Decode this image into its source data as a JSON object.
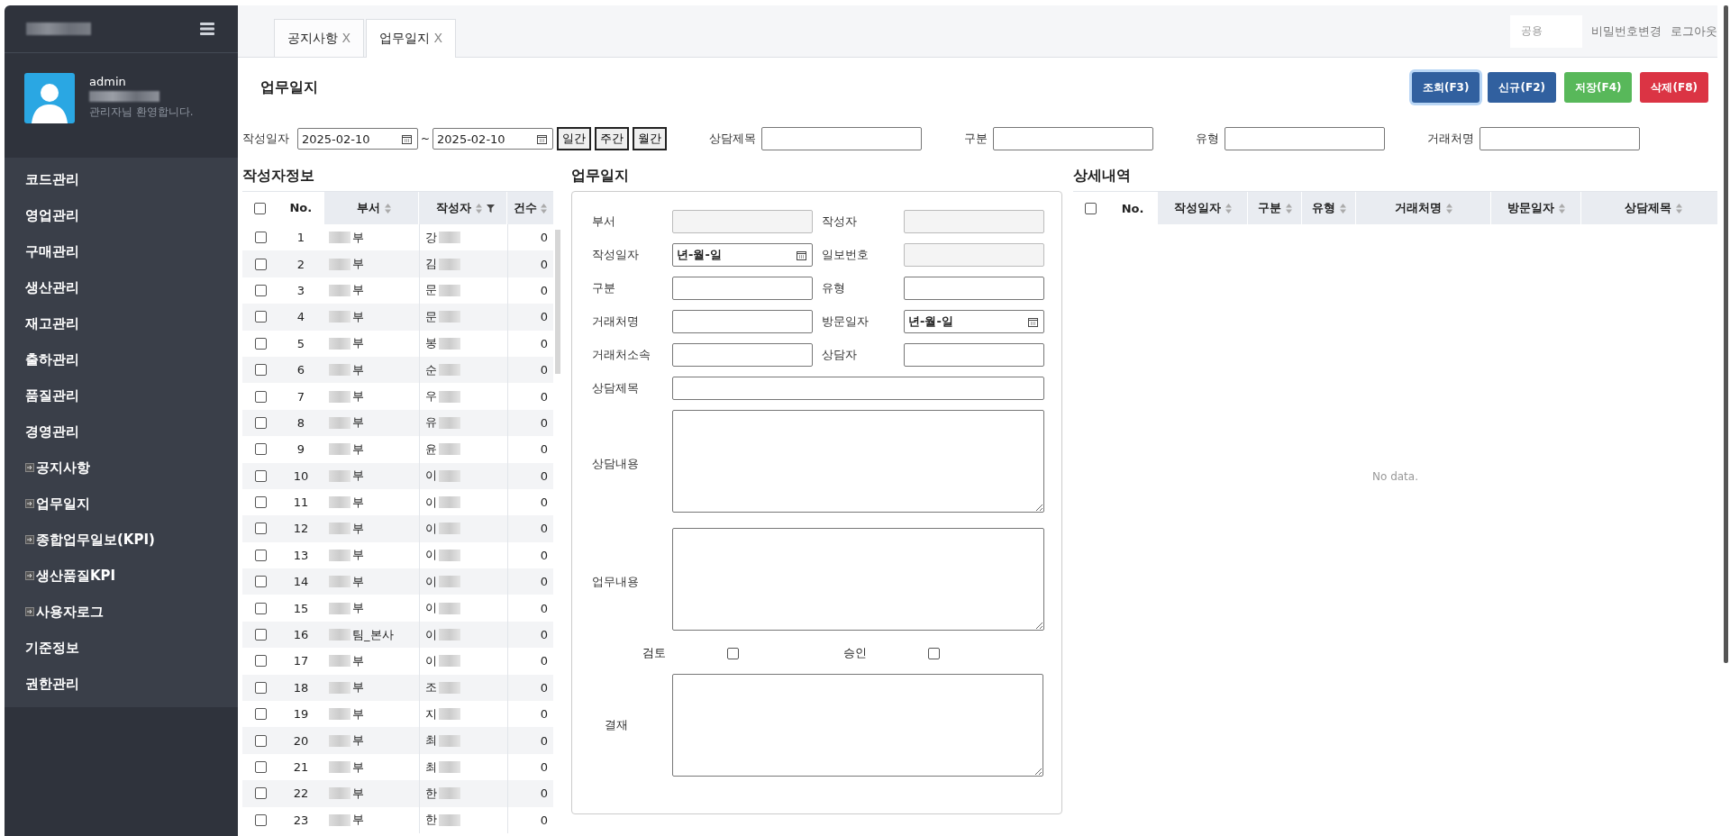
{
  "sidebar": {
    "user": {
      "name": "admin",
      "greeting": "관리자님 환영합니다."
    },
    "menu": [
      {
        "label": "코드관리",
        "kind": "group"
      },
      {
        "label": "영업관리",
        "kind": "group"
      },
      {
        "label": "구매관리",
        "kind": "group"
      },
      {
        "label": "생산관리",
        "kind": "group"
      },
      {
        "label": "재고관리",
        "kind": "group"
      },
      {
        "label": "출하관리",
        "kind": "group"
      },
      {
        "label": "품질관리",
        "kind": "group"
      },
      {
        "label": "경영관리",
        "kind": "group"
      },
      {
        "label": "공지사항",
        "kind": "page"
      },
      {
        "label": "업무일지",
        "kind": "page"
      },
      {
        "label": "종합업무일보(KPI)",
        "kind": "page"
      },
      {
        "label": "생산품질KPI",
        "kind": "page"
      },
      {
        "label": "사용자로그",
        "kind": "page"
      },
      {
        "label": "기준정보",
        "kind": "group"
      },
      {
        "label": "권한관리",
        "kind": "group"
      }
    ]
  },
  "tabs": [
    {
      "label": "공지사항",
      "close": "X",
      "selected": false
    },
    {
      "label": "업무일지",
      "close": "X",
      "selected": true
    }
  ],
  "top_links": {
    "field_value": "공용",
    "links": [
      "비밀번호변경",
      "로그아웃"
    ]
  },
  "page_title": "업무일지",
  "buttons": [
    {
      "label": "조회(F3)",
      "kind": "search"
    },
    {
      "label": "신규(F2)",
      "kind": "new"
    },
    {
      "label": "저장(F4)",
      "kind": "save"
    },
    {
      "label": "삭제(F8)",
      "kind": "delete"
    }
  ],
  "filters": {
    "date_label": "작성일자",
    "date_from": "2025-02-10",
    "separator": "~",
    "date_to": "2025-02-10",
    "period_buttons": [
      "일간",
      "주간",
      "월간"
    ],
    "fields": [
      {
        "label": "상담제목"
      },
      {
        "label": "구분"
      },
      {
        "label": "유형"
      },
      {
        "label": "거래처명"
      }
    ]
  },
  "writers": {
    "title": "작성자정보",
    "header_checked": false,
    "columns": [
      "No.",
      "부서",
      "작성자",
      "건수"
    ],
    "rows": [
      {
        "no": "1",
        "dept": "부",
        "writer": "강",
        "count": "0",
        "checked": false
      },
      {
        "no": "2",
        "dept": "부",
        "writer": "김",
        "count": "0",
        "checked": false
      },
      {
        "no": "3",
        "dept": "부",
        "writer": "문",
        "count": "0",
        "checked": false
      },
      {
        "no": "4",
        "dept": "부",
        "writer": "문",
        "count": "0",
        "checked": false
      },
      {
        "no": "5",
        "dept": "부",
        "writer": "봉",
        "count": "0",
        "checked": false
      },
      {
        "no": "6",
        "dept": "부",
        "writer": "순",
        "count": "0",
        "checked": false
      },
      {
        "no": "7",
        "dept": "부",
        "writer": "우",
        "count": "0",
        "checked": false
      },
      {
        "no": "8",
        "dept": "부",
        "writer": "유",
        "count": "0",
        "checked": false
      },
      {
        "no": "9",
        "dept": "부",
        "writer": "윤",
        "count": "0",
        "checked": false
      },
      {
        "no": "10",
        "dept": "부",
        "writer": "이",
        "count": "0",
        "checked": false
      },
      {
        "no": "11",
        "dept": "부",
        "writer": "이",
        "count": "0",
        "checked": false
      },
      {
        "no": "12",
        "dept": "부",
        "writer": "이",
        "count": "0",
        "checked": false
      },
      {
        "no": "13",
        "dept": "부",
        "writer": "이",
        "count": "0",
        "checked": false
      },
      {
        "no": "14",
        "dept": "부",
        "writer": "이",
        "count": "0",
        "checked": false
      },
      {
        "no": "15",
        "dept": "부",
        "writer": "이",
        "count": "0",
        "checked": false
      },
      {
        "no": "16",
        "dept": "팀_본사",
        "writer": "이",
        "count": "0",
        "checked": false
      },
      {
        "no": "17",
        "dept": "부",
        "writer": "이",
        "count": "0",
        "checked": false
      },
      {
        "no": "18",
        "dept": "부",
        "writer": "조",
        "count": "0",
        "checked": false
      },
      {
        "no": "19",
        "dept": "부",
        "writer": "지",
        "count": "0",
        "checked": false
      },
      {
        "no": "20",
        "dept": "부",
        "writer": "최",
        "count": "0",
        "checked": false
      },
      {
        "no": "21",
        "dept": "부",
        "writer": "최",
        "count": "0",
        "checked": false
      },
      {
        "no": "22",
        "dept": "부",
        "writer": "한",
        "count": "0",
        "checked": false
      },
      {
        "no": "23",
        "dept": "부",
        "writer": "한",
        "count": "0",
        "checked": false
      }
    ]
  },
  "form": {
    "title": "업무일지",
    "fields": [
      {
        "label": "부서",
        "kind": "disabled"
      },
      {
        "label": "작성자",
        "kind": "disabled"
      },
      {
        "label": "작성일자",
        "kind": "date",
        "placeholder": "년-월-일"
      },
      {
        "label": "일보번호",
        "kind": "disabled"
      },
      {
        "label": "구분",
        "kind": "text"
      },
      {
        "label": "유형",
        "kind": "text"
      },
      {
        "label": "거래처명",
        "kind": "text"
      },
      {
        "label": "방문일자",
        "kind": "date",
        "placeholder": "년-월-일"
      },
      {
        "label": "거래처소속",
        "kind": "text"
      },
      {
        "label": "상담자",
        "kind": "text"
      },
      {
        "label": "상담제목",
        "kind": "wide"
      },
      {
        "label": "상담내용",
        "kind": "textarea"
      },
      {
        "label": "업무내용",
        "kind": "textarea"
      }
    ],
    "checks": [
      {
        "label": "검토",
        "checked": false
      },
      {
        "label": "승인",
        "checked": false
      }
    ],
    "approval_label": "결재"
  },
  "details": {
    "title": "상세내역",
    "header_checked": false,
    "columns": [
      "No.",
      "작성일자",
      "구분",
      "유형",
      "거래처명",
      "방문일자",
      "상담제목"
    ],
    "empty": "No data."
  }
}
